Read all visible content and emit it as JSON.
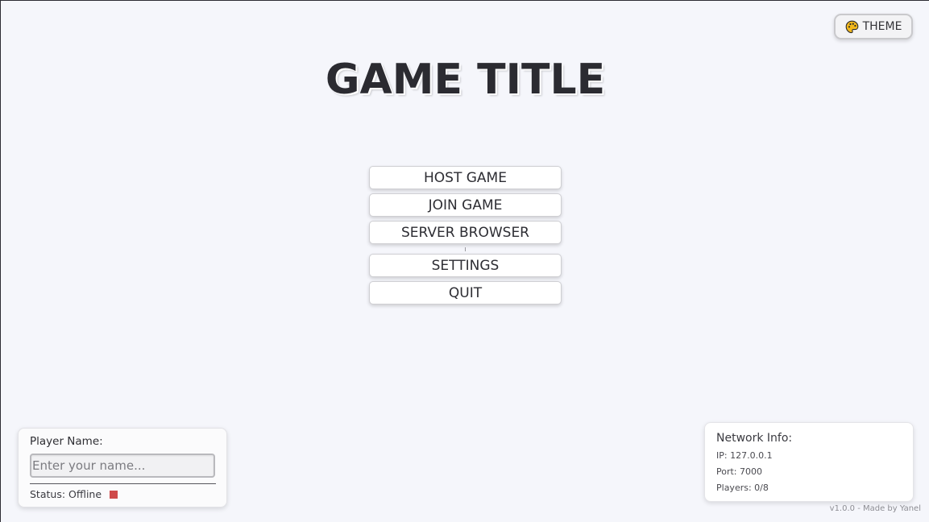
{
  "theme_button": {
    "label": "THEME",
    "icon": "palette-icon",
    "icon_color": "#f2b81d"
  },
  "title": "GAME TITLE",
  "menu": {
    "host": "HOST GAME",
    "join": "JOIN GAME",
    "server_browser": "SERVER BROWSER",
    "settings": "SETTINGS",
    "quit": "QUIT"
  },
  "player_panel": {
    "label": "Player Name:",
    "input_placeholder": "Enter your name...",
    "input_value": "",
    "status_text": "Status: Offline",
    "status_color": "#cf4a4a"
  },
  "network_panel": {
    "title": "Network Info:",
    "ip": "IP: 127.0.0.1",
    "port": "Port: 7000",
    "players": "Players: 0/8"
  },
  "version": "v1.0.0 - Made by Yanel",
  "colors": {
    "background": "#f5f6fb",
    "text": "#2e2e33",
    "button_bg": "#ffffff"
  }
}
